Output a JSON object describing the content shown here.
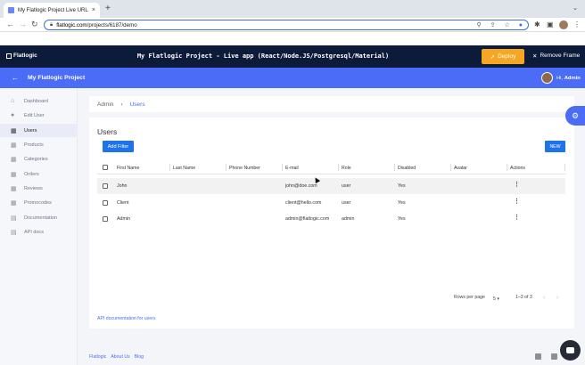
{
  "browser": {
    "tab_title": "My Flatlogic Project Live URL",
    "tab_close": "×",
    "new_tab": "+",
    "tab_menu": "⌄",
    "url_domain": "flatlogic.com",
    "url_path": "/projects/6187/demo"
  },
  "flatlogic_bar": {
    "logo": "Flatlogic",
    "title": "My Flatlogic Project - Live app (React/Node.JS/Postgresql/Material)",
    "deploy": "Deploy",
    "remove_frame": "Remove Frame"
  },
  "app_header": {
    "title": "My Flatlogic Project",
    "greeting": "Hi,",
    "user": "Admin"
  },
  "sidebar": {
    "items": [
      {
        "label": "Dashboard",
        "icon": "home-icon"
      },
      {
        "label": "Edit User",
        "icon": "account-icon"
      },
      {
        "label": "Users",
        "icon": "grid-icon"
      },
      {
        "label": "Products",
        "icon": "grid-icon"
      },
      {
        "label": "Categories",
        "icon": "grid-icon"
      },
      {
        "label": "Orders",
        "icon": "grid-icon"
      },
      {
        "label": "Reviews",
        "icon": "grid-icon"
      },
      {
        "label": "Promocodes",
        "icon": "grid-icon"
      },
      {
        "label": "Documentation",
        "icon": "document-icon"
      },
      {
        "label": "API docs",
        "icon": "document-icon"
      }
    ],
    "active_index": 2
  },
  "breadcrumb": {
    "root": "Admin",
    "separator": "›",
    "current": "Users"
  },
  "users_card": {
    "title": "Users",
    "add_filter": "Add Filter",
    "new": "NEW",
    "columns": [
      "First Name",
      "Last Name",
      "Phone Number",
      "E-mail",
      "Role",
      "Disabled",
      "Avatar",
      "Actions"
    ],
    "rows": [
      {
        "first_name": "John",
        "last_name": "",
        "phone": "",
        "email": "john@doe.com",
        "role": "user",
        "disabled": "Yes"
      },
      {
        "first_name": "Client",
        "last_name": "",
        "phone": "",
        "email": "client@hello.com",
        "role": "user",
        "disabled": "Yes"
      },
      {
        "first_name": "Admin",
        "last_name": "",
        "phone": "",
        "email": "admin@flatlogic.com",
        "role": "admin",
        "disabled": "Yes"
      }
    ],
    "rows_per_page_label": "Rows per page",
    "rows_per_page_value": "5",
    "range": "1–3 of 3",
    "api_doc_link": "API documentation for users"
  },
  "footer": {
    "links": [
      "Flatlogic",
      "About Us",
      "Blog"
    ]
  },
  "colors": {
    "accent": "#4a6cf7",
    "deploy": "#f5a623",
    "button_blue": "#1f73e8",
    "topbar": "#0d1b3a"
  }
}
